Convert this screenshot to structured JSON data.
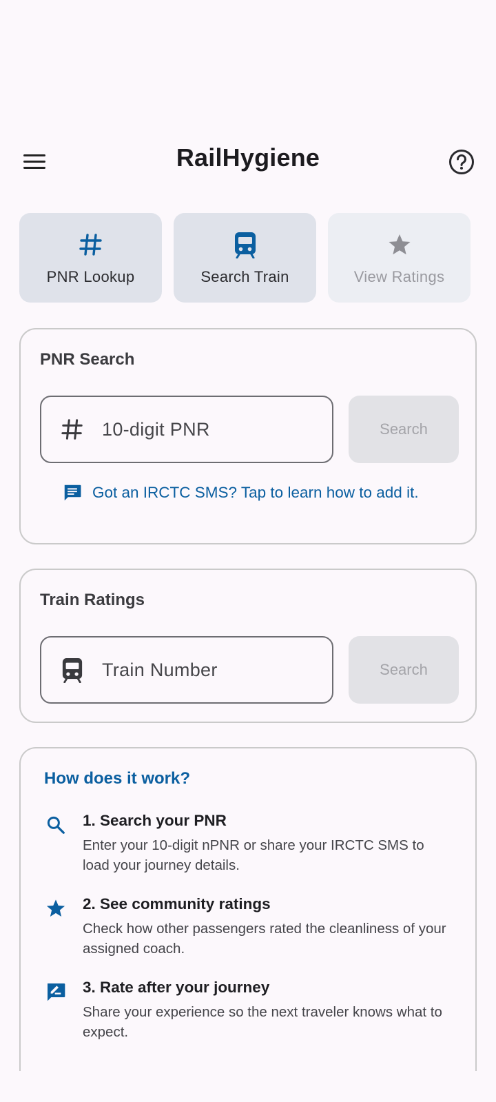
{
  "app_bar": {
    "title": "RailHygiene",
    "menu_icon": "hamburger-menu-icon",
    "help_icon": "help-circle-icon"
  },
  "tiles": [
    {
      "label": "PNR Lookup",
      "icon": "hash-icon",
      "enabled": true
    },
    {
      "label": "Search Train",
      "icon": "train-icon",
      "enabled": true
    },
    {
      "label": "View Ratings",
      "icon": "star-icon",
      "enabled": false
    }
  ],
  "pnr_search": {
    "title": "PNR Search",
    "placeholder": "10-digit PNR",
    "button_label": "Search",
    "sms_link": "Got an IRCTC SMS? Tap to learn how to add it."
  },
  "train_ratings": {
    "title": "Train Ratings",
    "placeholder": "Train Number",
    "button_label": "Search"
  },
  "how_it_works": {
    "title": "How does it work?",
    "steps": [
      {
        "icon": "search-icon",
        "title": "1. Search your PNR",
        "description": "Enter your 10-digit nPNR or share your IRCTC SMS to load your journey details."
      },
      {
        "icon": "star-icon",
        "title": "2. See community ratings",
        "description": "Check how other passengers rated the cleanliness of your assigned coach."
      },
      {
        "icon": "rate-review-icon",
        "title": "3. Rate after your journey",
        "description": "Share your experience so the next traveler knows what to expect."
      }
    ]
  },
  "colors": {
    "accent": "#0b5fa0",
    "background": "#fcf8fc",
    "tile": "#dfe2ea",
    "tile_disabled": "#eceef3"
  }
}
